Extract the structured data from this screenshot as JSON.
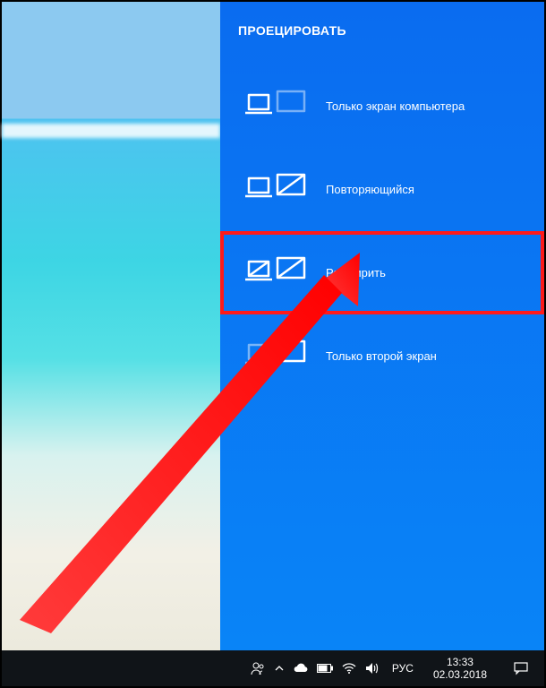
{
  "panel": {
    "title": "ПРОЕЦИРОВАТЬ",
    "options": [
      {
        "label": "Только экран компьютера"
      },
      {
        "label": "Повторяющийся"
      },
      {
        "label": "Расширить"
      },
      {
        "label": "Только второй экран"
      }
    ]
  },
  "taskbar": {
    "language": "РУС",
    "time": "13:33",
    "date": "02.03.2018"
  }
}
